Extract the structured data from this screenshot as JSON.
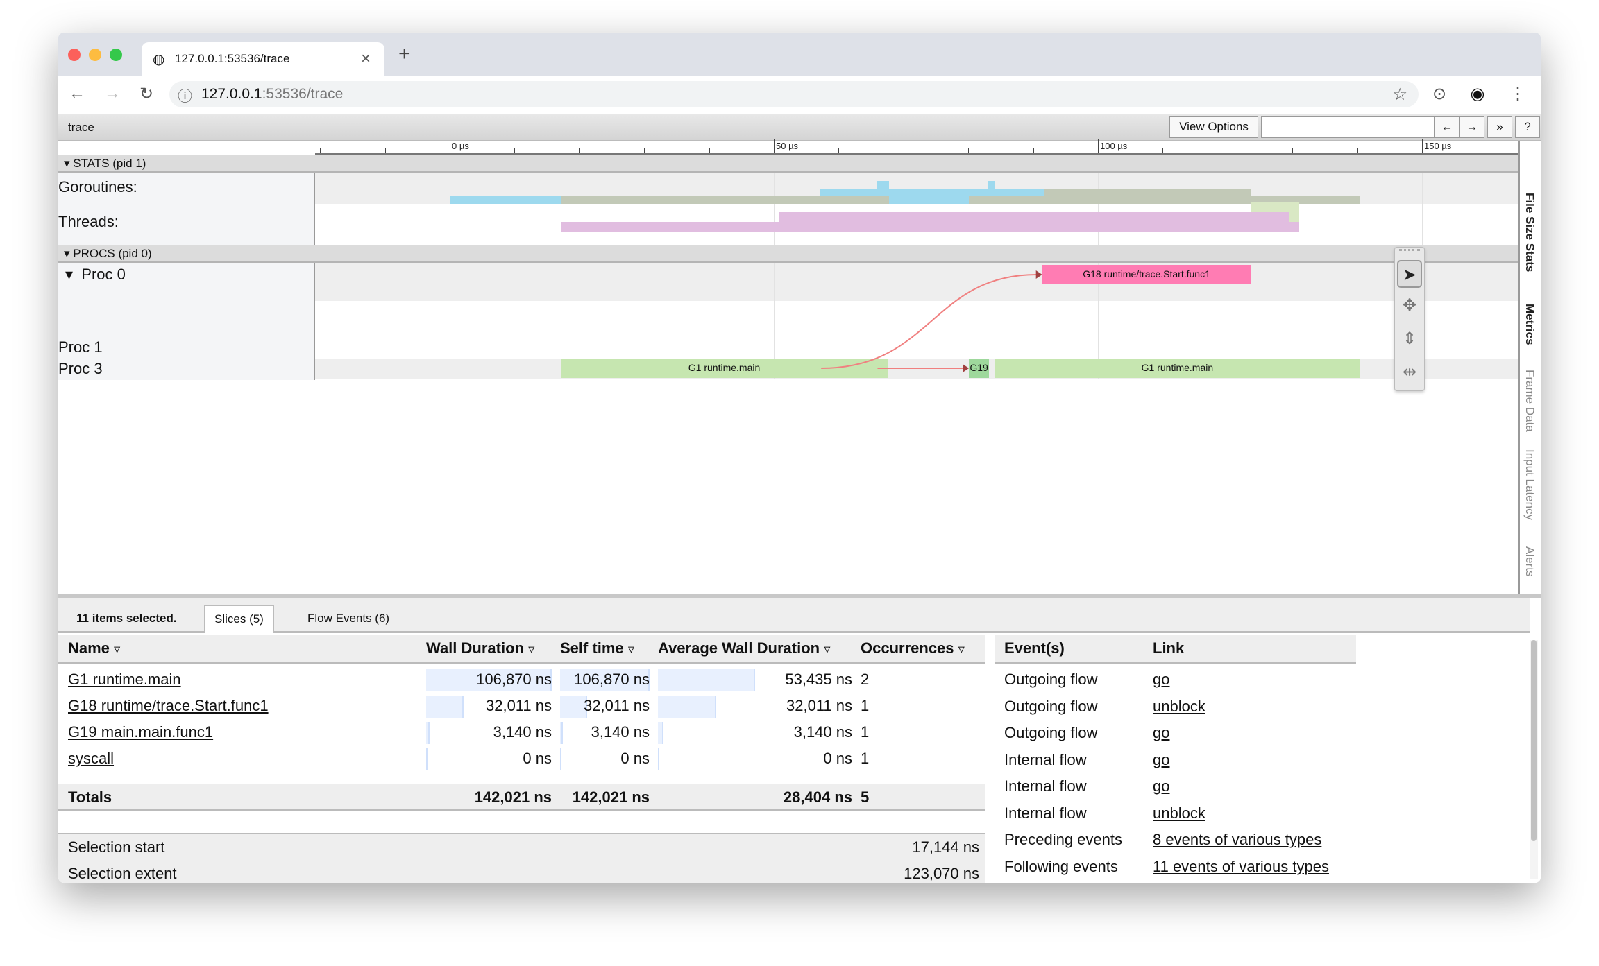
{
  "browser": {
    "tab_title": "127.0.0.1:53536/trace",
    "url_host": "127.0.0.1",
    "url_rest": ":53536/trace",
    "new_tab": "+",
    "close": "×"
  },
  "trace_toolbar": {
    "title": "trace",
    "view_options": "View Options",
    "search_value": "",
    "prev": "←",
    "next": "→",
    "more": "»",
    "help": "?"
  },
  "timeline": {
    "unit": "µs",
    "ticks": [
      {
        "t": 0,
        "label": "0 µs"
      },
      {
        "t": 50,
        "label": "50 µs"
      },
      {
        "t": 100,
        "label": "100 µs"
      },
      {
        "t": 150,
        "label": "150 µs"
      }
    ],
    "stats_header": "STATS (pid 1)",
    "procs_header": "PROCS (pid 0)",
    "goroutines_label": "Goroutines:",
    "threads_label": "Threads:",
    "proc_labels": [
      "Proc 0",
      "Proc 1",
      "Proc 3"
    ],
    "colors": {
      "running": "#9dd9ee",
      "runnable": "#c2c9b7",
      "syscall": "#e1bde0",
      "thread_green": "#d9e8c4",
      "g1": "#c6e6b0",
      "g18": "#ff7cb3",
      "g19": "#9ed89c",
      "flow": "#f08080"
    },
    "goroutine_segments": [
      [
        0,
        17.1,
        0,
        1
      ],
      [
        17.1,
        57.2,
        1,
        0
      ],
      [
        57.2,
        65.8,
        1,
        1
      ],
      [
        65.8,
        67.8,
        1,
        2
      ],
      [
        67.8,
        80.1,
        0,
        2
      ],
      [
        80.1,
        83.0,
        1,
        1
      ],
      [
        83.0,
        84.0,
        1,
        2
      ],
      [
        84.0,
        91.6,
        1,
        1
      ],
      [
        91.6,
        123.6,
        2,
        0
      ],
      [
        123.6,
        140.5,
        1,
        0
      ]
    ],
    "thread_segments": [
      [
        17.1,
        50.9,
        1,
        0
      ],
      [
        50.9,
        123.6,
        2,
        0
      ],
      [
        123.6,
        129.6,
        2,
        1
      ],
      [
        129.6,
        131.0,
        1,
        2
      ]
    ],
    "slices": [
      {
        "proc": 2,
        "start": 17.1,
        "end": 67.6,
        "label": "G1 runtime.main",
        "color": "g1"
      },
      {
        "proc": 2,
        "start": 80.1,
        "end": 83.2,
        "label": "G19",
        "color": "g19"
      },
      {
        "proc": 2,
        "start": 84.0,
        "end": 140.5,
        "label": "G1 runtime.main",
        "color": "g1"
      },
      {
        "proc": 0,
        "start": 91.4,
        "end": 123.6,
        "label": "G18 runtime/trace.Start.func1",
        "color": "g18"
      }
    ],
    "flows": [
      {
        "from_proc": 2,
        "from_t": 57.3,
        "to_proc": 0,
        "to_t": 91.4
      },
      {
        "from_proc": 2,
        "from_t": 66.0,
        "to_proc": 2,
        "to_t": 80.1
      }
    ]
  },
  "side_tabs": [
    "File Size Stats",
    "Metrics",
    "Frame Data",
    "Input Latency",
    "Alerts"
  ],
  "tools": [
    "select-tool",
    "pan-tool",
    "zoom-tool",
    "timing-tool"
  ],
  "bottom": {
    "summary": "11 items selected.",
    "tabs": [
      "Slices (5)",
      "Flow Events (6)"
    ],
    "columns": [
      "Name",
      "Wall Duration",
      "Self time",
      "Average Wall Duration",
      "Occurrences"
    ],
    "rows": [
      {
        "name": "G1 runtime.main",
        "wall": "106,870 ns",
        "self": "106,870 ns",
        "avg": "53,435 ns",
        "occ": "2",
        "frac": 1.0,
        "afrac": 1.0
      },
      {
        "name": "G18 runtime/trace.Start.func1",
        "wall": "32,011 ns",
        "self": "32,011 ns",
        "avg": "32,011 ns",
        "occ": "1",
        "frac": 0.3,
        "afrac": 0.6
      },
      {
        "name": "G19 main.main.func1",
        "wall": "3,140 ns",
        "self": "3,140 ns",
        "avg": "3,140 ns",
        "occ": "1",
        "frac": 0.03,
        "afrac": 0.06
      },
      {
        "name": "syscall",
        "wall": "0 ns",
        "self": "0 ns",
        "avg": "0 ns",
        "occ": "1",
        "frac": 0,
        "afrac": 0
      }
    ],
    "totals": {
      "label": "Totals",
      "wall": "142,021 ns",
      "self": "142,021 ns",
      "avg": "28,404 ns",
      "occ": "5"
    },
    "selection_start": {
      "label": "Selection start",
      "value": "17,144 ns"
    },
    "selection_extent": {
      "label": "Selection extent",
      "value": "123,070 ns"
    },
    "events_columns": [
      "Event(s)",
      "Link"
    ],
    "events": [
      {
        "event": "Outgoing flow",
        "link": "go"
      },
      {
        "event": "Outgoing flow",
        "link": "unblock"
      },
      {
        "event": "Outgoing flow",
        "link": "go"
      },
      {
        "event": "Internal flow",
        "link": "go"
      },
      {
        "event": "Internal flow",
        "link": "go"
      },
      {
        "event": "Internal flow",
        "link": "unblock"
      },
      {
        "event": "Preceding events",
        "link": "8 events of various types"
      },
      {
        "event": "Following events",
        "link": "11 events of various types"
      }
    ]
  }
}
